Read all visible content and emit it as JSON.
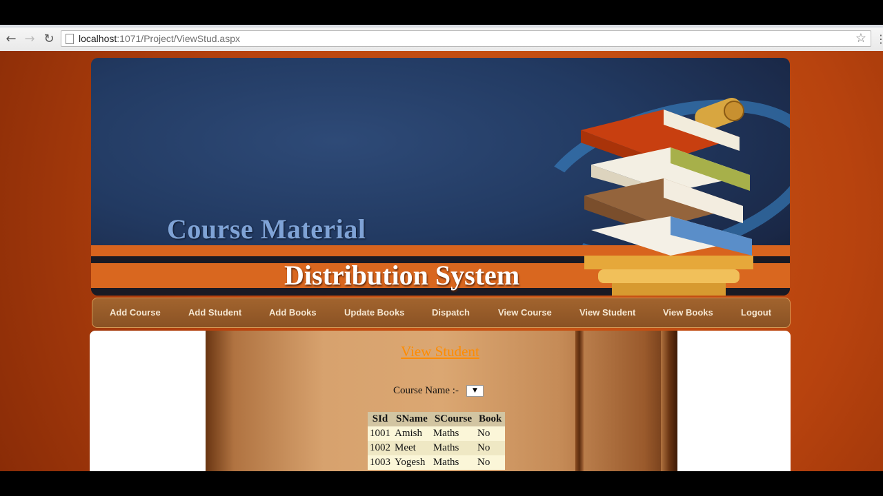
{
  "browser": {
    "url_host": "localhost",
    "url_rest": ":1071/Project/ViewStud.aspx"
  },
  "banner": {
    "title_line1": "Course Material",
    "title_line2": "Distribution System"
  },
  "menu": {
    "items": [
      {
        "label": "Add Course"
      },
      {
        "label": "Add Student"
      },
      {
        "label": "Add Books"
      },
      {
        "label": "Update Books"
      },
      {
        "label": "Dispatch"
      },
      {
        "label": "View Course"
      },
      {
        "label": "View Student"
      },
      {
        "label": "View Books"
      },
      {
        "label": "Logout"
      }
    ]
  },
  "main": {
    "heading": "View Student",
    "course_label": "Course Name :-",
    "course_select_value": "",
    "table": {
      "headers": [
        "SId",
        "SName",
        "SCourse",
        "Book"
      ],
      "rows": [
        [
          "1001",
          "Amish",
          "Maths",
          "No"
        ],
        [
          "1002",
          "Meet",
          "Maths",
          "No"
        ],
        [
          "1003",
          "Yogesh",
          "Maths",
          "No"
        ]
      ]
    }
  },
  "colors": {
    "page_background": "#b8430e",
    "heading_link": "#ff8c00",
    "menu_bar": "#8a5224"
  }
}
